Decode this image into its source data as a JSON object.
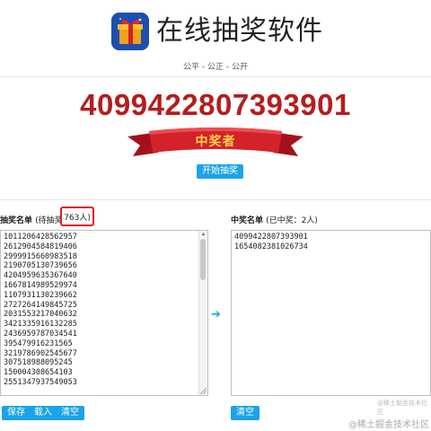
{
  "header": {
    "title": "在线抽奖软件",
    "tagline": "公平 - 公正 - 公开",
    "logo_icon": "gift-box-icon"
  },
  "winner": {
    "number": "4099422807393901",
    "ribbon_label": "中奖者",
    "start_button": "开始抽奖"
  },
  "pending": {
    "label": "抽奖名单",
    "sub_label": "(待抽奖",
    "count": "763人)",
    "entries": [
      "1011206428562957",
      "2612904584819406",
      "2999915660983518",
      "2190705130739656",
      "4204959635367640",
      "1667814989529974",
      "1107931130239662",
      "2727264149845725",
      "2031553217040632",
      "3421335916132285",
      "2436959787034541",
      "395479916231565",
      "3219786902545677",
      "307518988095245",
      "150004308654103",
      "2551347937549053"
    ],
    "buttons": {
      "save": "保存",
      "load": "载入",
      "clear": "清空"
    }
  },
  "winners": {
    "label": "中奖名单",
    "sub_label": "(已中奖：2人)",
    "entries": [
      "4099422807393901",
      "1654082381026734"
    ],
    "buttons": {
      "clear": "清空"
    }
  },
  "transfer_icon": "arrow-right-icon",
  "watermarks": {
    "small": "@稀土掘金技术社区",
    "large": "@稀土掘金技术社区"
  },
  "colors": {
    "accent": "#1aa3e8",
    "winner_red": "#b51d1d",
    "highlight_border": "#e11b1b",
    "ribbon_gold": "#ffd54a"
  }
}
